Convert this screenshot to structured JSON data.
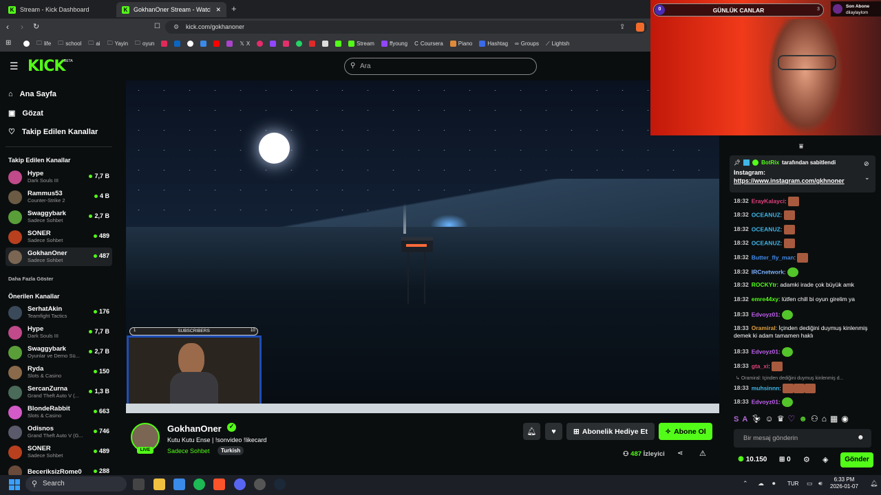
{
  "browser": {
    "tabs": [
      {
        "label": "Stream - Kick Dashboard"
      },
      {
        "label": "GokhanOner Stream - Watch Live"
      }
    ],
    "url": "kick.com/gokhanoner",
    "bookmarks": [
      "life",
      "school",
      "ai",
      "Yayin",
      "oyun",
      "X",
      "Stream",
      "ffyoung",
      "Coursera",
      "Piano",
      "Hashtag",
      "Groups",
      "Lightsh"
    ]
  },
  "kick": {
    "logo": "KICK",
    "beta": "BETA",
    "search_placeholder": "Ara"
  },
  "sidebar": {
    "nav": [
      "Ana Sayfa",
      "Gözat",
      "Takip Edilen Kanallar"
    ],
    "followed_title": "Takip Edilen Kanallar",
    "followed": [
      {
        "name": "Hype",
        "game": "Dark Souls III",
        "viewers": "7,7 B",
        "color": "#c04a8a"
      },
      {
        "name": "Rammus53",
        "game": "Counter-Strike 2",
        "viewers": "4 B",
        "color": "#6b5a44"
      },
      {
        "name": "Swaggybark",
        "game": "Sadece Sohbet",
        "viewers": "2,7 B",
        "color": "#5a9e3a"
      },
      {
        "name": "SONER",
        "game": "Sadece Sohbet",
        "viewers": "489",
        "color": "#b8401e"
      },
      {
        "name": "GokhanOner",
        "game": "Sadece Sohbet",
        "viewers": "487",
        "color": "#7a6653"
      }
    ],
    "show_more": "Daha Fazla Göster",
    "recommended_title": "Önerilen Kanallar",
    "recommended": [
      {
        "name": "SerhatAkin",
        "game": "Teamfight Tactics",
        "viewers": "176",
        "color": "#3a4a5a"
      },
      {
        "name": "Hype",
        "game": "Dark Souls III",
        "viewers": "7,7 B",
        "color": "#c04a8a"
      },
      {
        "name": "Swaggybark",
        "game": "Oyunlar ve Demo Sü...",
        "viewers": "2,7 B",
        "color": "#5a9e3a"
      },
      {
        "name": "Ryda",
        "game": "Slots & Casino",
        "viewers": "150",
        "color": "#8a6a4a"
      },
      {
        "name": "SercanZurna",
        "game": "Grand Theft Auto V (...",
        "viewers": "1,3 B",
        "color": "#4a6a5a"
      },
      {
        "name": "BlondeRabbit",
        "game": "Slots & Casino",
        "viewers": "663",
        "color": "#d45ac8"
      },
      {
        "name": "Odisnos",
        "game": "Grand Theft Auto V (G...",
        "viewers": "746",
        "color": "#5a5a6a"
      },
      {
        "name": "SONER",
        "game": "Sadece Sohbet",
        "viewers": "489",
        "color": "#b8401e"
      },
      {
        "name": "BeceriksizRome0",
        "game": "",
        "viewers": "288",
        "color": "#6a4a3a"
      }
    ]
  },
  "video": {
    "subscribers_label": "SUBSCRIBERS",
    "subscribers_left": "1",
    "subscribers_right": "10"
  },
  "channel": {
    "name": "GokhanOner",
    "live": "LIVE",
    "title": "Kutu Kutu Ense | !sonvideo !likecard",
    "category": "Sadece Sohbet",
    "tag": "Turkish",
    "gift_label": "Abonelik Hediye Et",
    "sub_label": "Abone Ol",
    "viewers": "487",
    "viewers_label": "İzleyici"
  },
  "overlay": {
    "bar_title": "GÜNLÜK CANLAR",
    "bar_left": "0",
    "bar_right": "3",
    "son_abone": "Son Abone",
    "son_abone_user": "dilaylaylom"
  },
  "chat": {
    "pinned_by": "BotRix",
    "pinned_suffix": "tarafından sabitlendi",
    "pinned_title": "Instagram:",
    "pinned_link": "https://www.instagram.com/gkhnoner",
    "messages": [
      {
        "time": "18:32",
        "user": "ErayKalayci",
        "color": "#e0407a",
        "text": "",
        "emote": true
      },
      {
        "time": "18:32",
        "user": "OCEANUZ",
        "color": "#3fb6e8",
        "text": "",
        "emote": true
      },
      {
        "time": "18:32",
        "user": "OCEANUZ",
        "color": "#3fb6e8",
        "text": "",
        "emote": true
      },
      {
        "time": "18:32",
        "user": "OCEANUZ",
        "color": "#3fb6e8",
        "text": "",
        "emote": true
      },
      {
        "time": "18:32",
        "user": "Butter_fly_man",
        "color": "#3f8ae8",
        "text": "",
        "emote": true
      },
      {
        "time": "18:32",
        "user": "IRCnetwork",
        "color": "#7ab0ff",
        "text": "",
        "emote": true
      },
      {
        "time": "18:32",
        "user": "ROCKYtr",
        "color": "#53fc18",
        "text": "adamki irade çok büyük amk",
        "emote": false
      },
      {
        "time": "18:32",
        "user": "emre44xy",
        "color": "#53fc18",
        "text": "lütfen chill bi oyun girelim ya",
        "emote": false
      },
      {
        "time": "18:33",
        "user": "Edvoyz01",
        "color": "#c060f0",
        "text": "",
        "emote": true
      },
      {
        "time": "18:33",
        "user": "Oramiral",
        "color": "#e0a040",
        "text": "İçinden dediğini duymuş kinlenmiş demek ki adam tamamen haklı",
        "emote": false
      },
      {
        "time": "18:33",
        "user": "Edvoyz01",
        "color": "#c060f0",
        "text": "",
        "emote": true
      },
      {
        "time": "18:33",
        "user": "gta_xi",
        "color": "#e0407a",
        "text": "",
        "emote": true
      }
    ],
    "reply_preview": "Oramiral: İçinden dediğini duymuş kinlenmiş d...",
    "reply_msg": {
      "time": "18:33",
      "user": "muhsinnn",
      "color": "#3fb6e8"
    },
    "last_msg": {
      "time": "18:33",
      "user": "Edvoyz01",
      "color": "#c060f0"
    },
    "input_placeholder": "Bir mesaj gönderin",
    "points": "10.150",
    "gift_count": "0",
    "send_label": "Gönder"
  },
  "taskbar": {
    "search": "Search",
    "lang": "TUR",
    "time": "6:33 PM",
    "date": "2026-01-07"
  },
  "colors": {
    "kick_green": "#53fc18",
    "bg": "#0b0e0f",
    "panel": "#1f2225"
  }
}
